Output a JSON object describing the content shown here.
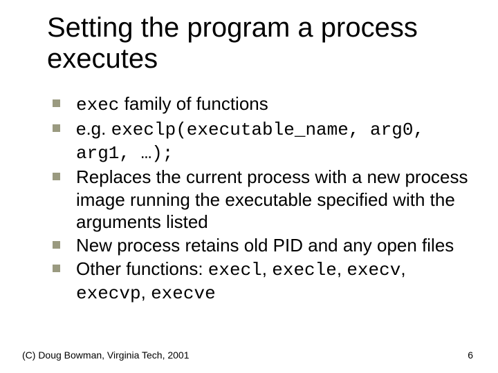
{
  "title": "Setting the program a process executes",
  "bullets": {
    "b0_pre_code": "exec",
    "b0_post": " family of functions",
    "b1_pre": "e.g. ",
    "b1_code": "execlp(executable_name, arg0, arg1, …);",
    "b2": "Replaces the current process with a new process image running the executable specified with the arguments listed",
    "b3": "New process retains old PID and any open files",
    "b4_pre": "Other functions: ",
    "b4_f0": "execl",
    "b4_f1": "execle",
    "b4_f2": "execv",
    "b4_f3": "execvp",
    "b4_f4": "execve",
    "sep": ", "
  },
  "footer": {
    "copyright": "(C) Doug Bowman, Virginia Tech, 2001",
    "page": "6"
  }
}
